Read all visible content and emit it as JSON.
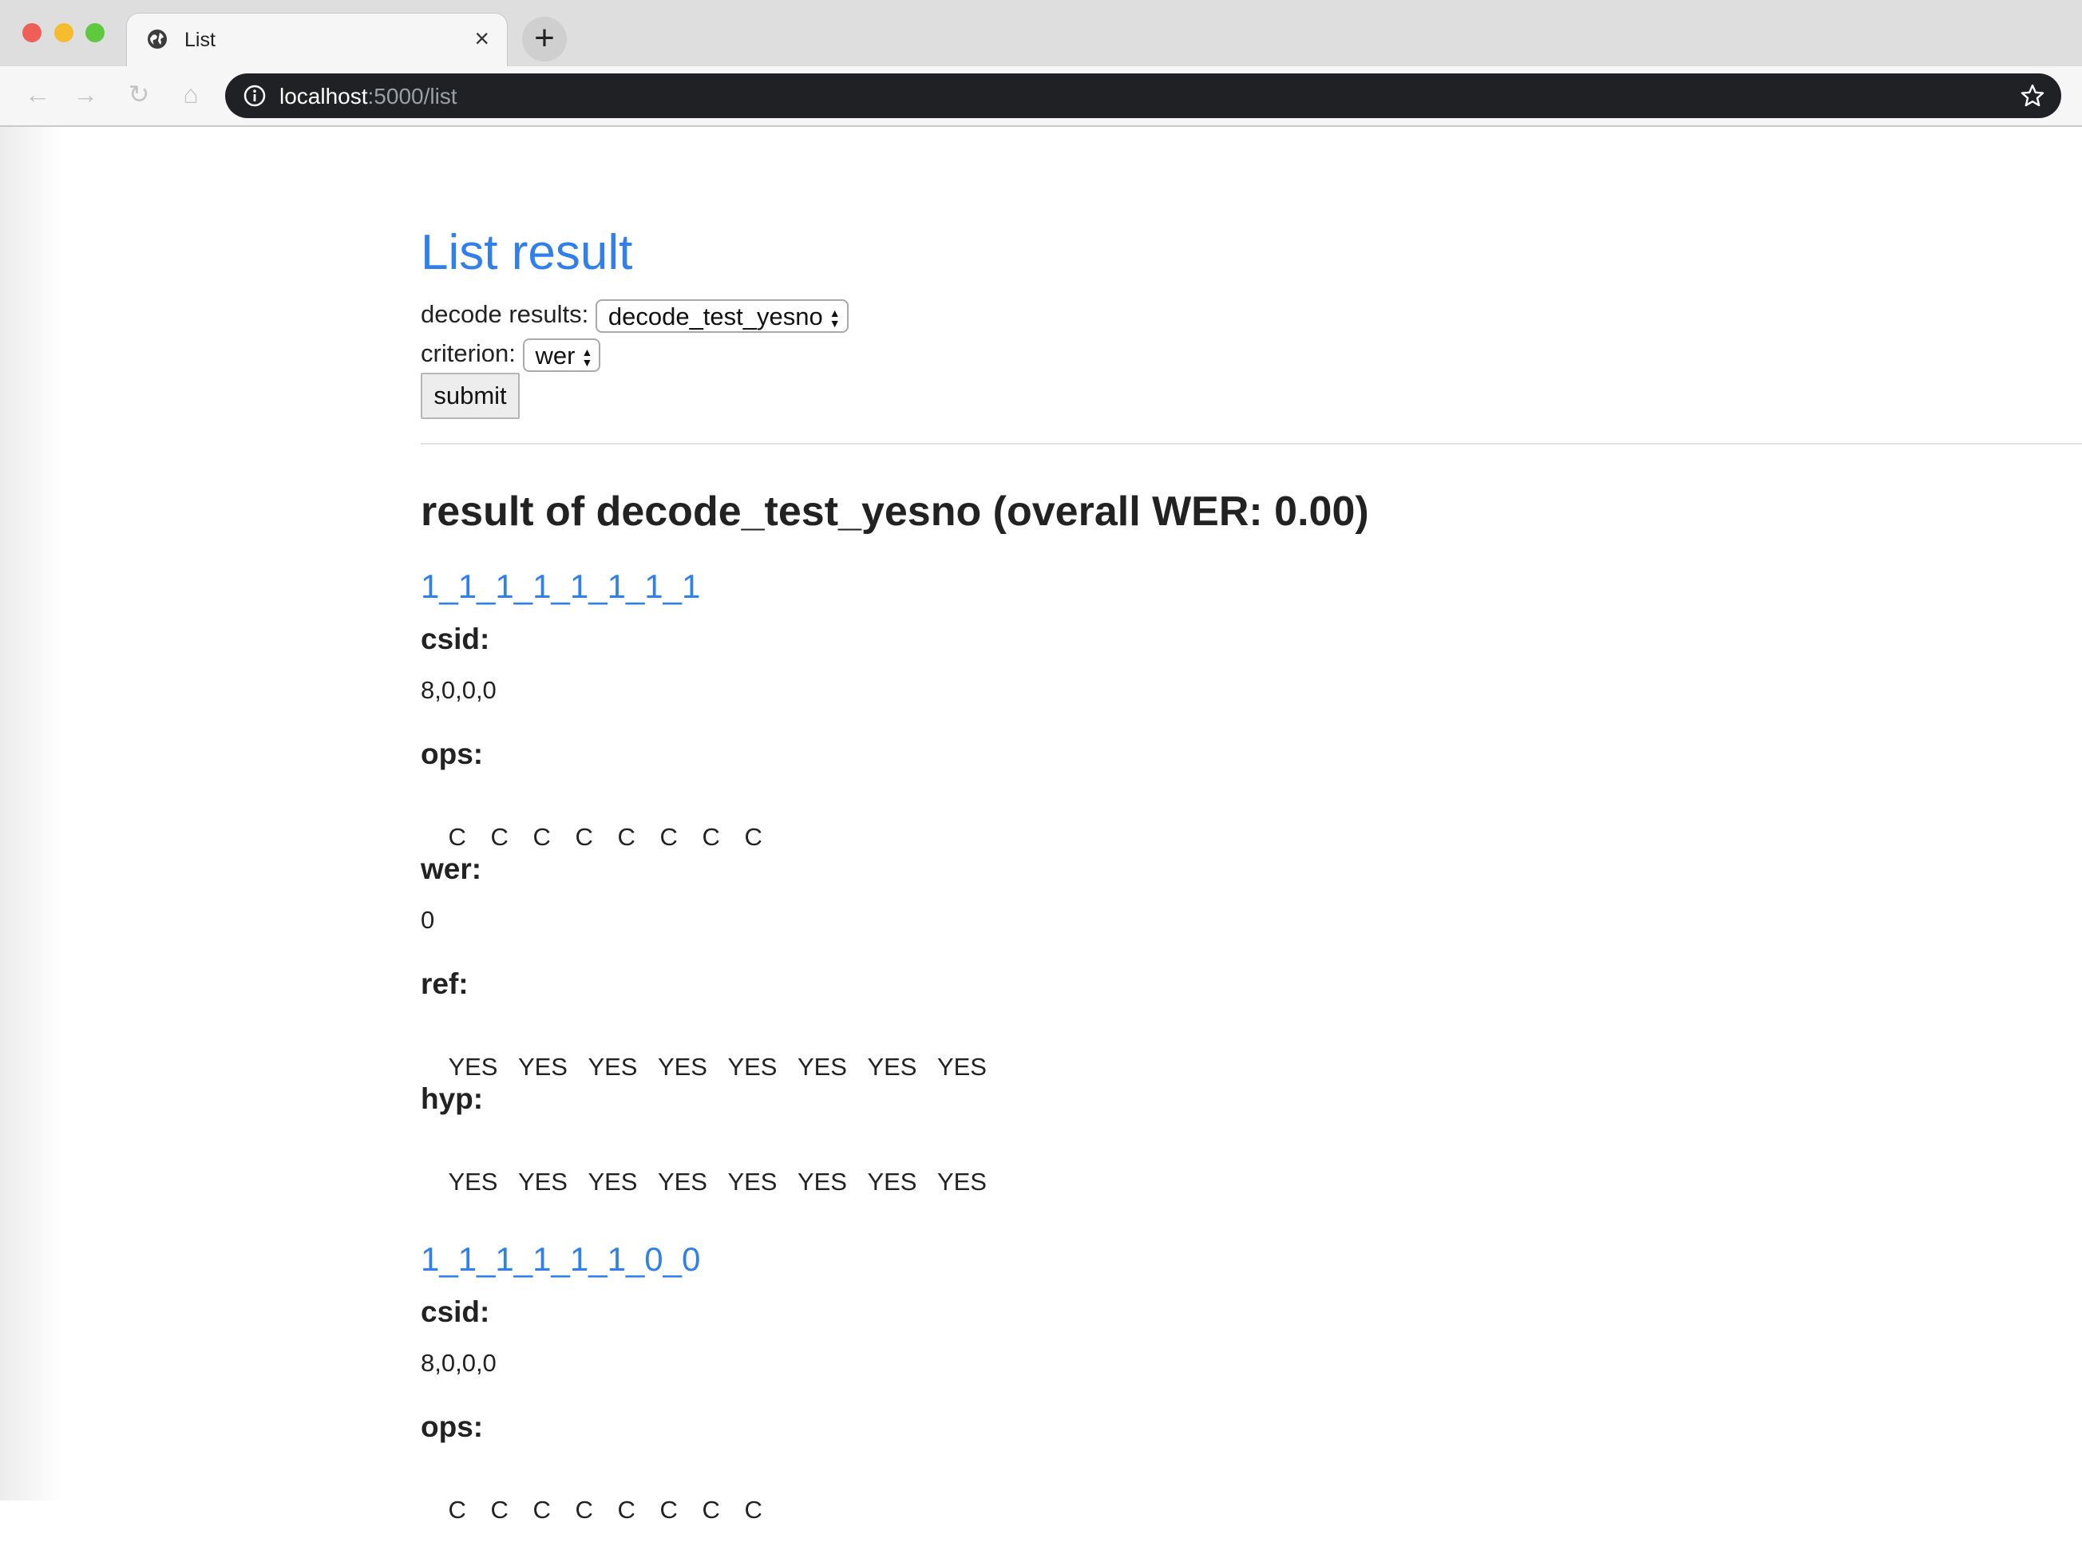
{
  "browser": {
    "tab_title": "List",
    "url_host": "localhost",
    "url_rest": ":5000/list",
    "new_tab_label": "+",
    "close_tab_label": "×"
  },
  "page": {
    "title": "List result",
    "form": {
      "decode_label": "decode results:",
      "decode_value": "decode_test_yesno",
      "criterion_label": "criterion:",
      "criterion_value": "wer",
      "submit_label": "submit"
    },
    "result_heading": "result of decode_test_yesno (overall WER: 0.00)",
    "labels": {
      "csid": "csid:",
      "ops": "ops:",
      "wer": "wer:",
      "ref": "ref:",
      "hyp": "hyp:"
    },
    "utterances": [
      {
        "id": "1_1_1_1_1_1_1_1",
        "csid": "8,0,0,0",
        "ops": [
          "C",
          "C",
          "C",
          "C",
          "C",
          "C",
          "C",
          "C"
        ],
        "wer": "0",
        "ref": [
          "YES",
          "YES",
          "YES",
          "YES",
          "YES",
          "YES",
          "YES",
          "YES"
        ],
        "hyp": [
          "YES",
          "YES",
          "YES",
          "YES",
          "YES",
          "YES",
          "YES",
          "YES"
        ]
      },
      {
        "id": "1_1_1_1_1_1_0_0",
        "csid": "8,0,0,0",
        "ops": [
          "C",
          "C",
          "C",
          "C",
          "C",
          "C",
          "C",
          "C"
        ]
      }
    ]
  }
}
